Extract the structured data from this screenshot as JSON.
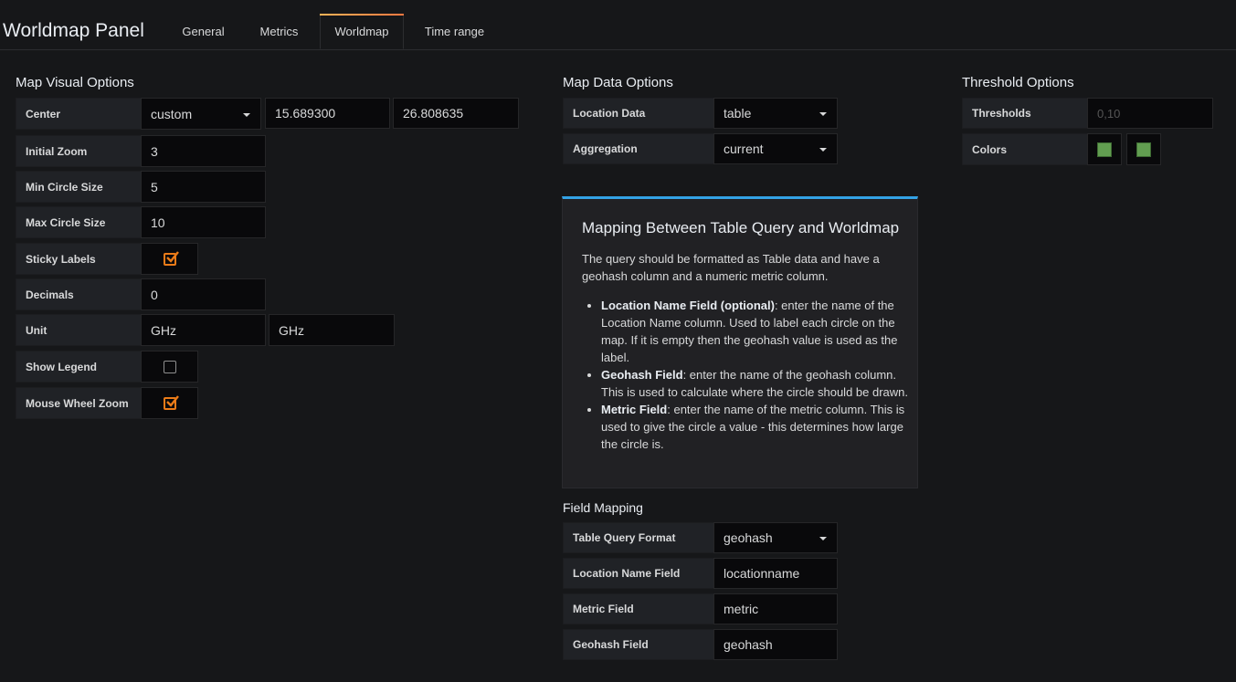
{
  "header": {
    "title": "Worldmap Panel",
    "tabs": [
      {
        "label": "General",
        "active": false
      },
      {
        "label": "Metrics",
        "active": false
      },
      {
        "label": "Worldmap",
        "active": true
      },
      {
        "label": "Time range",
        "active": false
      }
    ],
    "active_gradient": [
      "#ffb357",
      "#ff7941"
    ]
  },
  "map_visual": {
    "heading": "Map Visual Options",
    "center": {
      "label": "Center",
      "mode": "custom",
      "latitude": "15.689300",
      "longitude": "26.808635"
    },
    "initial_zoom": {
      "label": "Initial Zoom",
      "value": "3"
    },
    "min_circle": {
      "label": "Min Circle Size",
      "value": "5"
    },
    "max_circle": {
      "label": "Max Circle Size",
      "value": "10"
    },
    "sticky_labels": {
      "label": "Sticky Labels",
      "checked": true
    },
    "decimals": {
      "label": "Decimals",
      "value": "0"
    },
    "unit": {
      "label": "Unit",
      "value1": "GHz",
      "value2": "GHz"
    },
    "show_legend": {
      "label": "Show Legend",
      "checked": false
    },
    "mouse_wheel_zoom": {
      "label": "Mouse Wheel Zoom",
      "checked": true
    },
    "check_color": "#eb7b18"
  },
  "map_data": {
    "heading": "Map Data Options",
    "location_data": {
      "label": "Location Data",
      "value": "table"
    },
    "aggregation": {
      "label": "Aggregation",
      "value": "current"
    }
  },
  "info": {
    "title": "Mapping Between Table Query and Worldmap",
    "intro": "The query should be formatted as Table data and have a geohash column and a numeric metric column.",
    "items": [
      {
        "term": "Location Name Field (optional)",
        "text": ": enter the name of the Location Name column. Used to label each circle on the map. If it is empty then the geohash value is used as the label."
      },
      {
        "term": "Geohash Field",
        "text": ": enter the name of the geohash column. This is used to calculate where the circle should be drawn."
      },
      {
        "term": "Metric Field",
        "text": ": enter the name of the metric column. This is used to give the circle a value - this determines how large the circle is."
      }
    ],
    "accent": "#33a2e5"
  },
  "field_mapping": {
    "heading": "Field Mapping",
    "table_query_format": {
      "label": "Table Query Format",
      "value": "geohash"
    },
    "location_name_field": {
      "label": "Location Name Field",
      "value": "locationname"
    },
    "metric_field": {
      "label": "Metric Field",
      "value": "metric"
    },
    "geohash_field": {
      "label": "Geohash Field",
      "value": "geohash"
    }
  },
  "threshold": {
    "heading": "Threshold Options",
    "thresholds": {
      "label": "Thresholds",
      "placeholder": "0,10"
    },
    "colors": {
      "label": "Colors",
      "swatches": [
        "#629e51",
        "#629e51"
      ]
    }
  }
}
